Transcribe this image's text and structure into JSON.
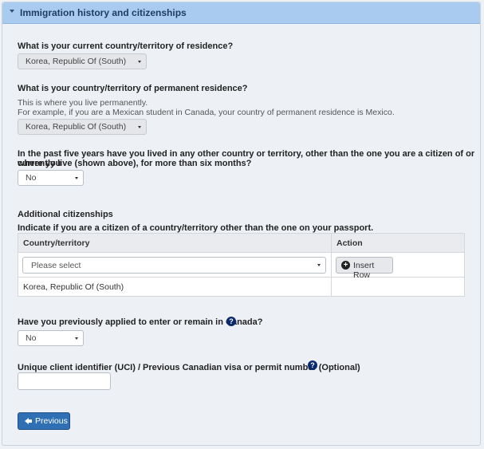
{
  "section": {
    "title": "Immigration history and citizenships"
  },
  "residence": {
    "question": "What is your current country/territory of residence?",
    "value": "Korea, Republic Of (South)"
  },
  "permanent": {
    "question": "What is your country/territory of permanent residence?",
    "help_line1": "This is where you live permanently.",
    "help_line2": "For example, if you are a Mexican student in Canada, your country of permanent residence is Mexico.",
    "value": "Korea, Republic Of (South)"
  },
  "past_five_years": {
    "question_line1": "In the past five years have you lived in any other country or territory, other than the one you are a citizen of or where you",
    "question_line2": "currently live (shown above), for more than six months?",
    "value": "No"
  },
  "citizenships": {
    "heading": "Additional citizenships",
    "instruction": "Indicate if you are a citizen of a country/territory other than the one on your passport.",
    "columns": [
      "Country/territory",
      "Action"
    ],
    "select_placeholder": "Please select",
    "insert_label": "Insert Row",
    "rows": [
      {
        "country": "Korea, Republic Of (South)",
        "action": ""
      }
    ]
  },
  "previous_application": {
    "question": "Have you previously applied to enter or remain in Canada?",
    "value": "No"
  },
  "uci": {
    "label": "Unique client identifier (UCI) / Previous Canadian visa or permit number (Optional)",
    "value": ""
  },
  "nav": {
    "previous_label": "Previous"
  },
  "icons": {
    "help": "?",
    "plus": "+"
  },
  "colors": {
    "header_bg": "#a9cbef",
    "primary_button": "#2f6fb3",
    "help_icon": "#0b2a6e"
  }
}
